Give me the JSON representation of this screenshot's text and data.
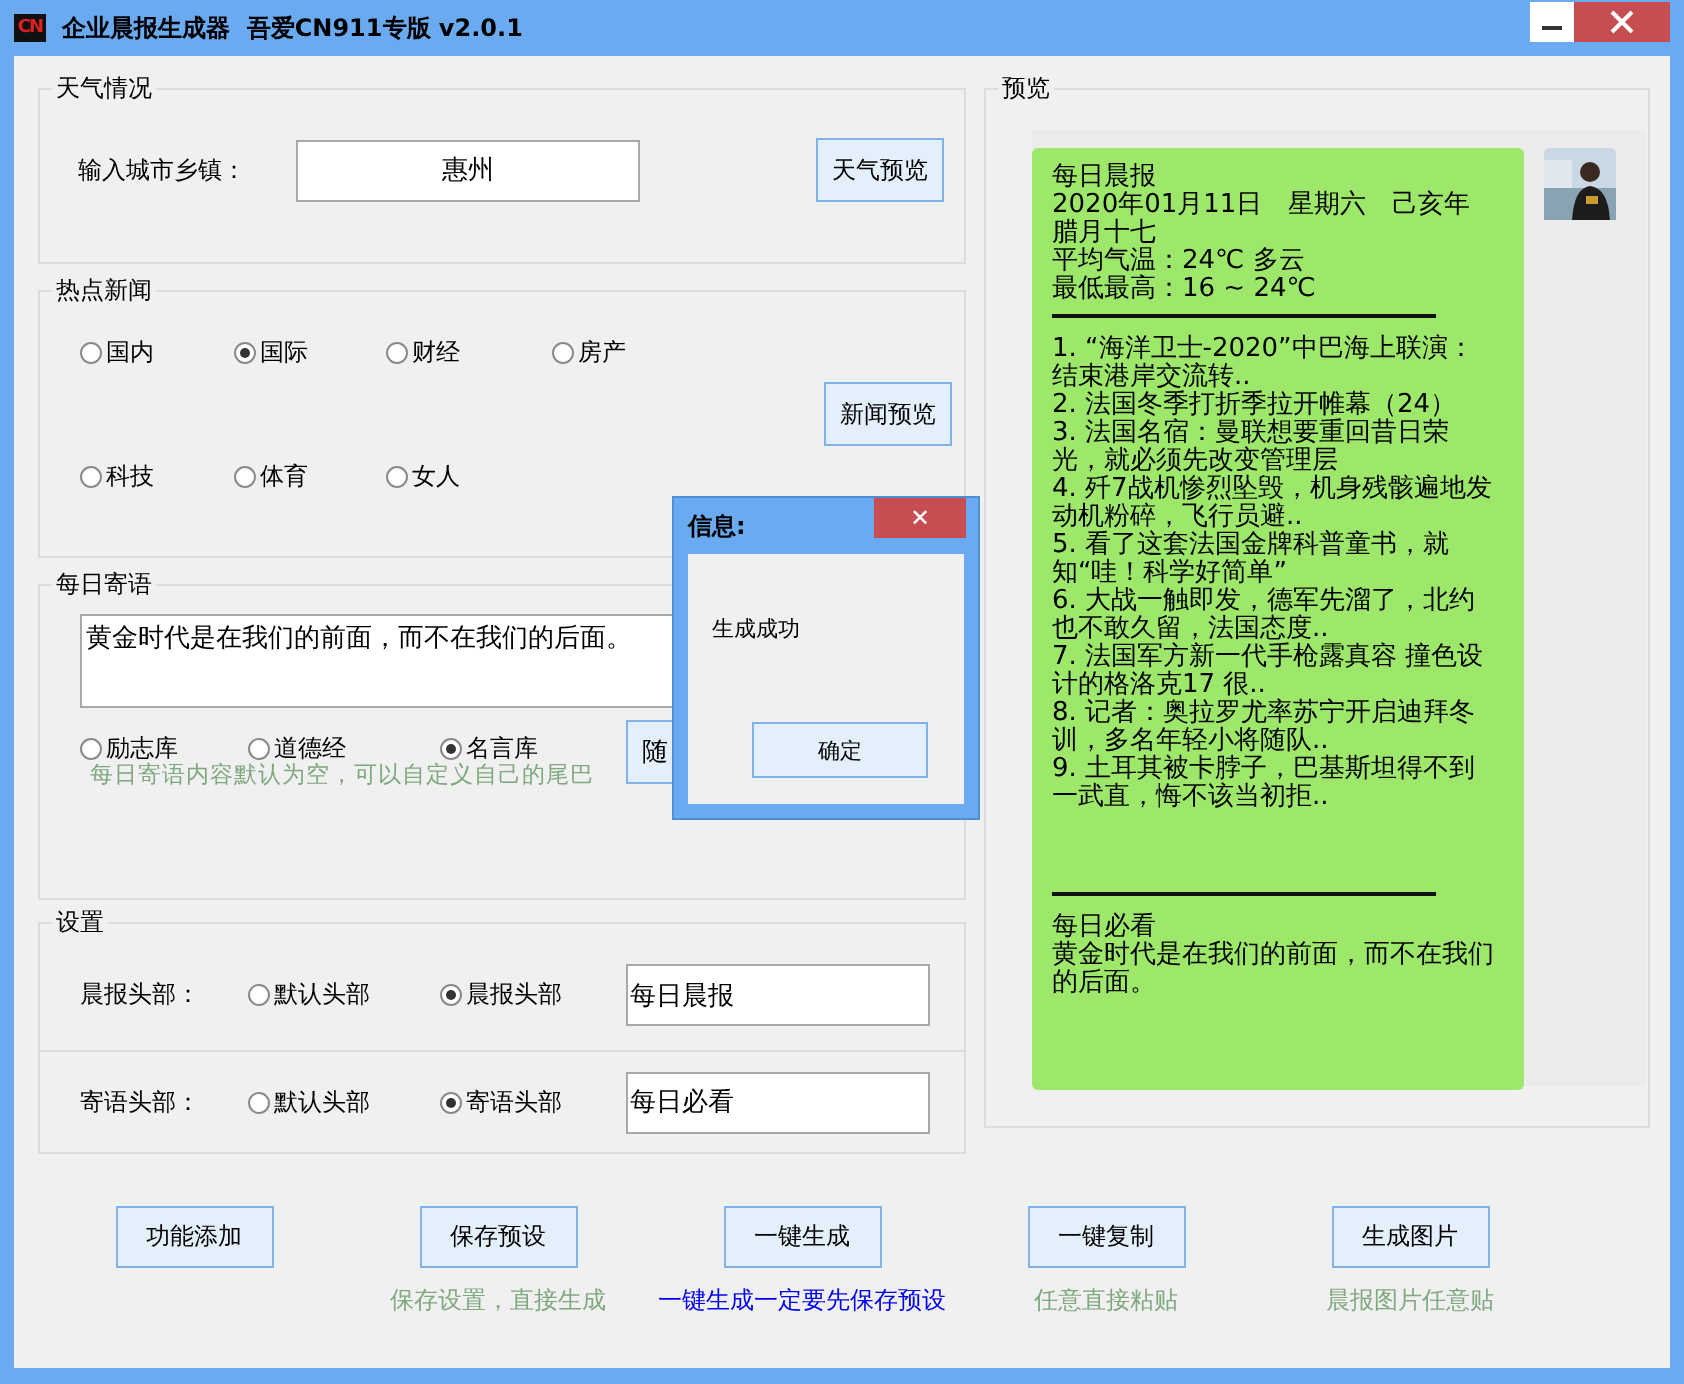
{
  "window": {
    "logo": "CN",
    "title": "企业晨报生成器  吾爱CN911专版 v2.0.1"
  },
  "weather": {
    "legend": "天气情况",
    "label": "输入城市乡镇：",
    "city": "惠州",
    "button": "天气预览"
  },
  "news": {
    "legend": "热点新闻",
    "options": [
      {
        "label": "国内",
        "selected": false
      },
      {
        "label": "国际",
        "selected": true
      },
      {
        "label": "财经",
        "selected": false
      },
      {
        "label": "房产",
        "selected": false
      },
      {
        "label": "科技",
        "selected": false
      },
      {
        "label": "体育",
        "selected": false
      },
      {
        "label": "女人",
        "selected": false
      }
    ],
    "button": "新闻预览"
  },
  "motto": {
    "legend": "每日寄语",
    "text": "黄金时代是在我们的前面，而不在我们的后面。",
    "options": [
      {
        "label": "励志库",
        "selected": false
      },
      {
        "label": "道德经",
        "selected": false
      },
      {
        "label": "名言库",
        "selected": true
      }
    ],
    "hint": "每日寄语内容默认为空，可以自定义自己的尾巴",
    "button": "随"
  },
  "settings": {
    "legend": "设置",
    "rows": [
      {
        "label": "晨报头部：",
        "options": [
          {
            "label": "默认头部",
            "selected": false
          },
          {
            "label": "晨报头部",
            "selected": true
          }
        ],
        "value": "每日晨报"
      },
      {
        "label": "寄语头部：",
        "options": [
          {
            "label": "默认头部",
            "selected": false
          },
          {
            "label": "寄语头部",
            "selected": true
          }
        ],
        "value": "每日必看"
      }
    ]
  },
  "preview": {
    "legend": "预览",
    "blocks": [
      {
        "kind": "text",
        "lines": [
          "每日晨报",
          "2020年01月11日　星期六　己亥年腊月十七",
          "平均气温：24℃ 多云",
          "最低最高：16 ~ 24℃"
        ]
      },
      {
        "kind": "rule"
      },
      {
        "kind": "text",
        "lines": [
          "1. “海洋卫士-2020”中巴海上联演：结束港岸交流转..",
          "2. 法国冬季打折季拉开帷幕（24）",
          "3. 法国名宿：曼联想要重回昔日荣光，就必须先改变管理层",
          "4. 歼7战机惨烈坠毁，机身残骸遍地发动机粉碎，飞行员避..",
          "5. 看了这套法国金牌科普童书，就知“哇！科学好简单”",
          "6. 大战一触即发，德军先溜了，北约也不敢久留，法国态度..",
          "7. 法国军方新一代手枪露真容 撞色设计的格洛克17 很..",
          "8. 记者：奥拉罗尤率苏宁开启迪拜冬训，多名年轻小将随队..",
          "9. 土耳其被卡脖子，巴基斯坦得不到一武直，悔不该当初拒.."
        ]
      },
      {
        "kind": "rule"
      },
      {
        "kind": "text",
        "lines": [
          "每日必看",
          "黄金时代是在我们的前面，而不在我们的后面。"
        ]
      }
    ]
  },
  "actions": [
    {
      "label": "功能添加"
    },
    {
      "label": "保存预设",
      "caption": "保存设置，直接生成",
      "highlight": false
    },
    {
      "label": "一键生成",
      "caption": "一键生成一定要先保存预设",
      "highlight": true
    },
    {
      "label": "一键复制",
      "caption": "任意直接粘贴",
      "highlight": false
    },
    {
      "label": "生成图片",
      "caption": "晨报图片任意贴",
      "highlight": false
    }
  ],
  "dialog": {
    "title": "信息:",
    "close": "✕",
    "message": "生成成功",
    "button": "确定"
  }
}
